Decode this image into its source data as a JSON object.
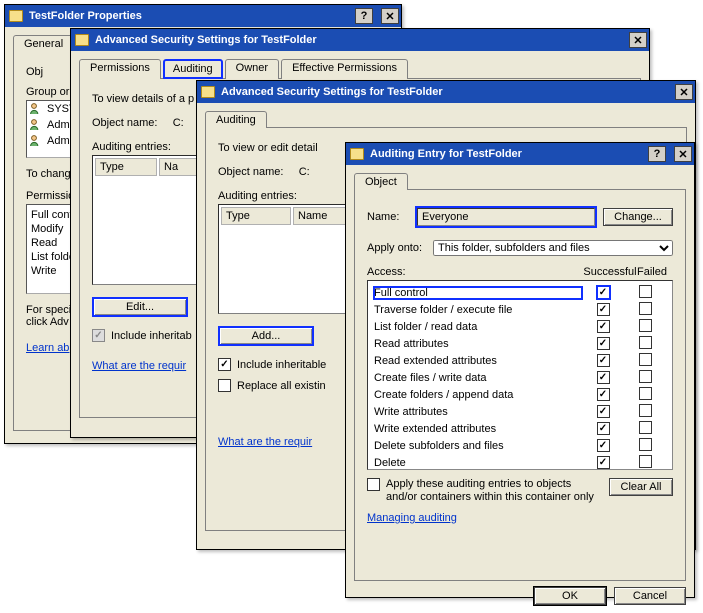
{
  "props": {
    "title": "TestFolder Properties",
    "tabs": {
      "general": "General"
    },
    "objectLead": "Obj",
    "groupLead": "Group or",
    "users": [
      "SYSTEM",
      "Administrators",
      "Administrator"
    ],
    "toChange": "To chang",
    "permLead": "Permissio",
    "perms": [
      "Full control",
      "Modify",
      "Read",
      "List folder",
      "Write"
    ],
    "forSpecial": "For speci",
    "clickAdv": "click Adv",
    "learn": "Learn ab"
  },
  "adv1": {
    "title": "Advanced Security Settings for TestFolder",
    "tabs": {
      "permissions": "Permissions",
      "auditing": "Auditing",
      "owner": "Owner",
      "effective": "Effective Permissions"
    },
    "viewdetails": "To view details of a p",
    "objname": "Object name:",
    "objval": "C:",
    "entries": "Auditing entries:",
    "cols": {
      "type": "Type",
      "name": "Na"
    },
    "edit": "Edit...",
    "inherit": "Include inheritab",
    "link": "What are the requir"
  },
  "adv2": {
    "title": "Advanced Security Settings for TestFolder",
    "tabs": {
      "auditing": "Auditing"
    },
    "viewdetails": "To view or edit detail",
    "objname": "Object name:",
    "objval": "C:",
    "entries": "Auditing entries:",
    "cols": {
      "type": "Type",
      "name": "Name"
    },
    "add": "Add...",
    "inherit": "Include inheritable",
    "replace": "Replace all existin",
    "link": "What are the requir"
  },
  "entry": {
    "title": "Auditing Entry for TestFolder",
    "tab": "Object",
    "nameLabel": "Name:",
    "nameValue": "Everyone",
    "change": "Change...",
    "applyOntoLabel": "Apply onto:",
    "applyOntoValue": "This folder, subfolders and files",
    "accessLabel": "Access:",
    "hdrS": "Successful",
    "hdrF": "Failed",
    "rows": [
      {
        "label": "Full control",
        "s": true,
        "f": false,
        "hl": true
      },
      {
        "label": "Traverse folder / execute file",
        "s": true,
        "f": false
      },
      {
        "label": "List folder / read data",
        "s": true,
        "f": false
      },
      {
        "label": "Read attributes",
        "s": true,
        "f": false
      },
      {
        "label": "Read extended attributes",
        "s": true,
        "f": false
      },
      {
        "label": "Create files / write data",
        "s": true,
        "f": false
      },
      {
        "label": "Create folders / append data",
        "s": true,
        "f": false
      },
      {
        "label": "Write attributes",
        "s": true,
        "f": false
      },
      {
        "label": "Write extended attributes",
        "s": true,
        "f": false
      },
      {
        "label": "Delete subfolders and files",
        "s": true,
        "f": false
      },
      {
        "label": "Delete",
        "s": true,
        "f": false
      }
    ],
    "applyEntries": "Apply these auditing entries to objects and/or containers within this container only",
    "applyEntriesChecked": false,
    "clearAll": "Clear All",
    "managing": "Managing auditing",
    "ok": "OK",
    "cancel": "Cancel"
  },
  "stray": {
    "apply": "ly"
  }
}
